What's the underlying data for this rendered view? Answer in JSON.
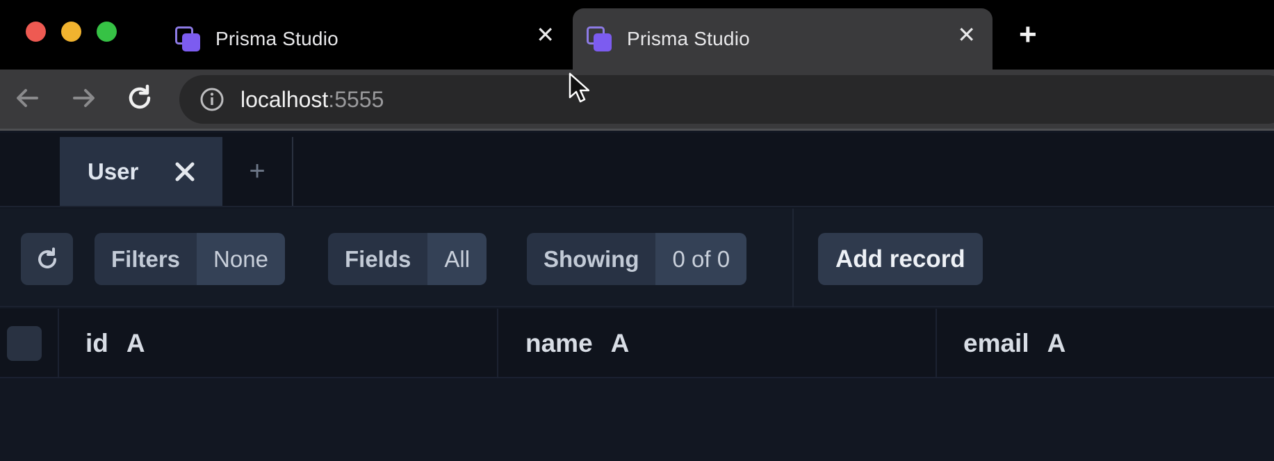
{
  "browser": {
    "tabs": [
      {
        "title": "Prisma Studio",
        "active": false
      },
      {
        "title": "Prisma Studio",
        "active": true
      }
    ],
    "close_glyph": "✕",
    "new_tab_glyph": "+",
    "url": {
      "host": "localhost",
      "port": ":5555"
    }
  },
  "studio": {
    "model_tabs": [
      {
        "label": "User"
      }
    ],
    "add_tab_glyph": "+",
    "filterbar": {
      "filters": {
        "label": "Filters",
        "value": "None"
      },
      "fields": {
        "label": "Fields",
        "value": "All"
      },
      "showing": {
        "label": "Showing",
        "value": "0 of 0"
      },
      "add_record_label": "Add record"
    },
    "columns": [
      {
        "name": "id",
        "type": "A"
      },
      {
        "name": "name",
        "type": "A"
      },
      {
        "name": "email",
        "type": "A"
      }
    ]
  },
  "colors": {
    "traffic_red": "#ee5a52",
    "traffic_yellow": "#f1b32f",
    "traffic_green": "#36c245",
    "prisma_purple": "#7c5cf0"
  }
}
